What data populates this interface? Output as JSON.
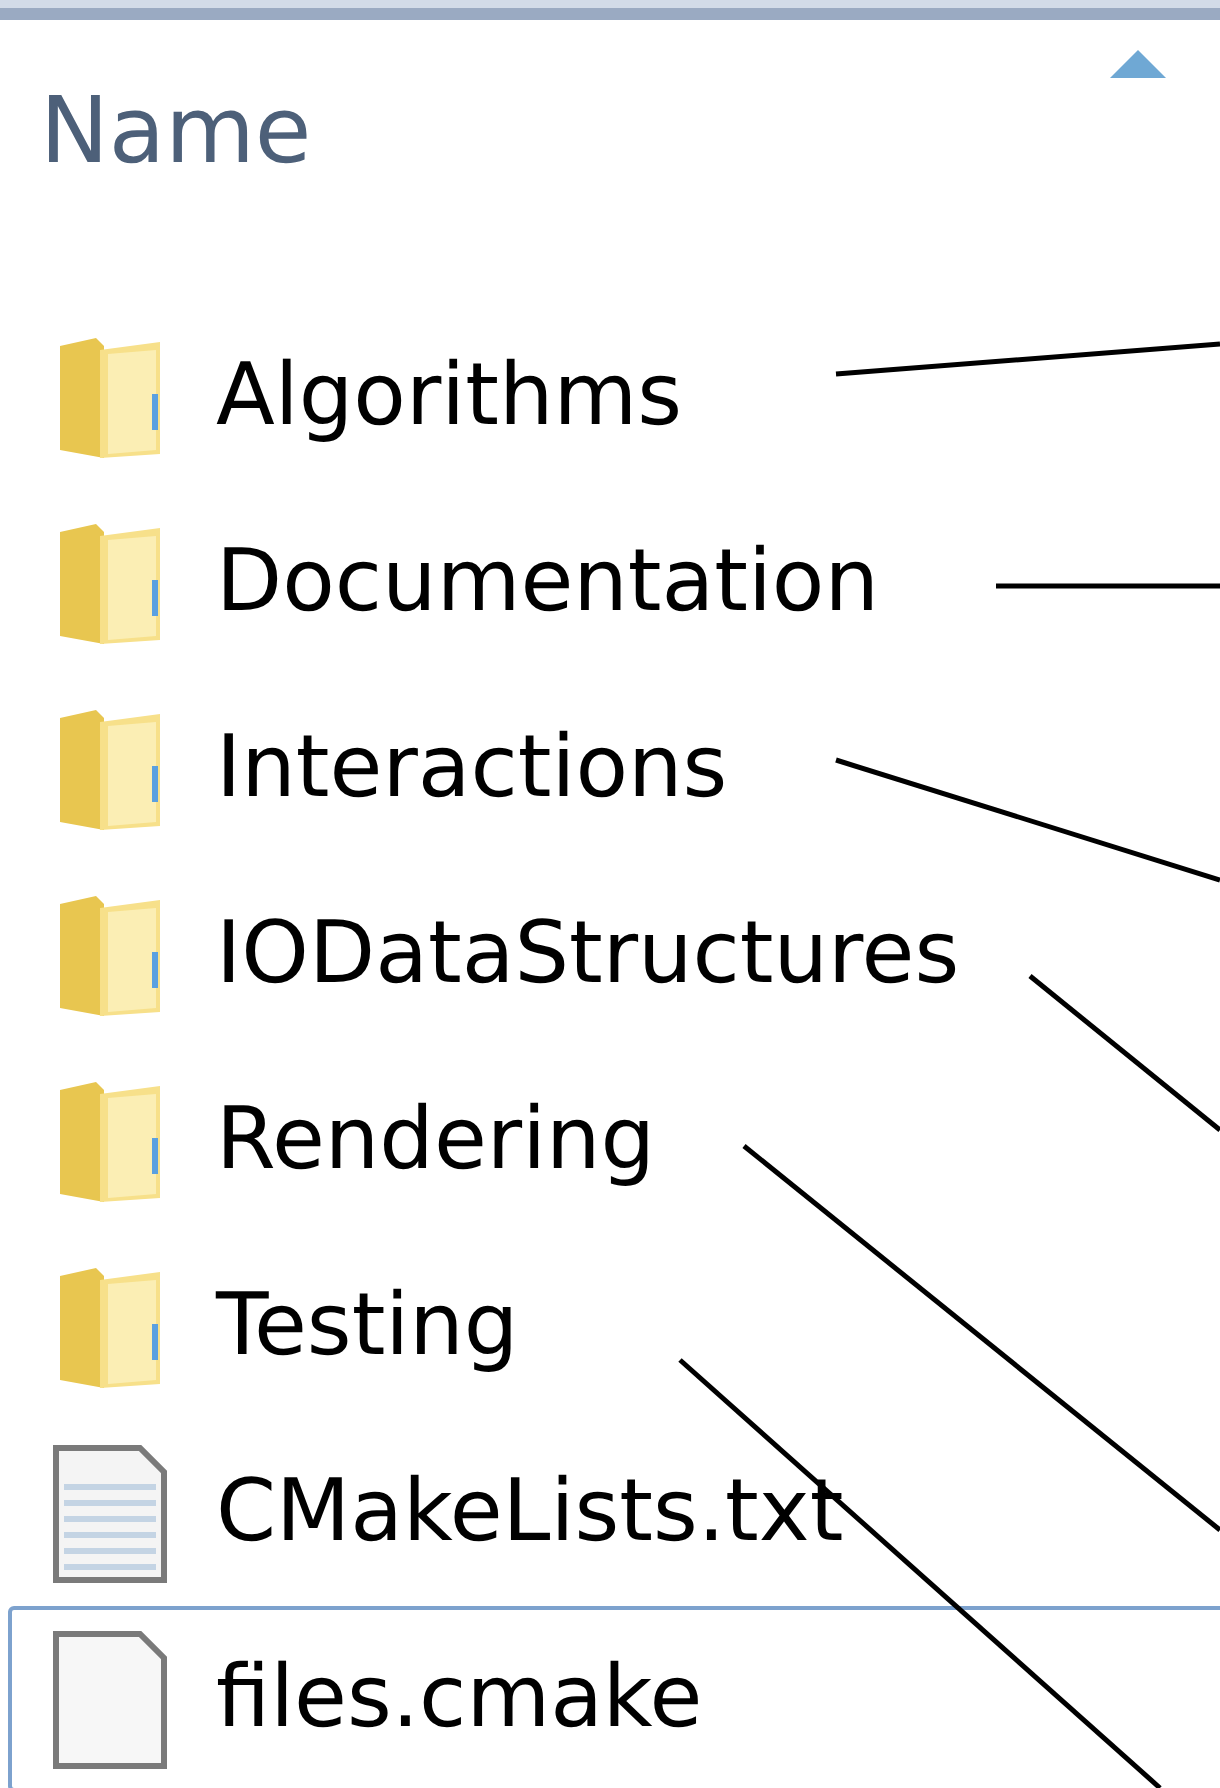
{
  "header": {
    "column": "Name",
    "sorted": true
  },
  "items": [
    {
      "name": "Algorithms",
      "kind": "folder",
      "focused": false
    },
    {
      "name": "Documentation",
      "kind": "folder",
      "focused": false
    },
    {
      "name": "Interactions",
      "kind": "folder",
      "focused": false
    },
    {
      "name": "IODataStructures",
      "kind": "folder",
      "focused": false
    },
    {
      "name": "Rendering",
      "kind": "folder",
      "focused": false
    },
    {
      "name": "Testing",
      "kind": "folder",
      "focused": false
    },
    {
      "name": "CMakeLists.txt",
      "kind": "text",
      "focused": false
    },
    {
      "name": "files.cmake",
      "kind": "file",
      "focused": true
    }
  ]
}
